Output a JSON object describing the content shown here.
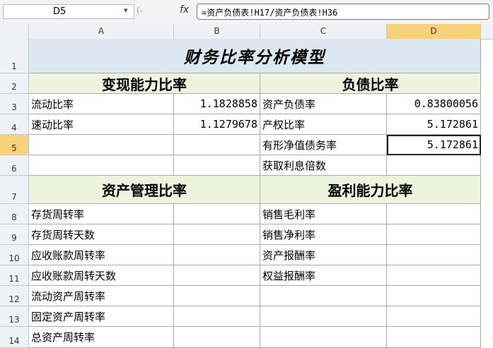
{
  "formula_bar": {
    "name_box": "D5",
    "formula": "=资产负债表!H17/资产负债表!H36",
    "fx_label": "fx"
  },
  "columns": [
    "A",
    "B",
    "C",
    "D"
  ],
  "selected_column": "D",
  "rows": [
    "1",
    "2",
    "3",
    "4",
    "5",
    "6",
    "7",
    "8",
    "9",
    "10",
    "11",
    "12",
    "13",
    "14"
  ],
  "selected_row": "5",
  "sheet": {
    "title": "财务比率分析模型",
    "sections": {
      "liquidity": "变现能力比率",
      "debt": "负债比率",
      "asset_mgmt": "资产管理比率",
      "profitability": "盈利能力比率"
    },
    "liquidity_items": [
      {
        "label": "流动比率",
        "value": "1.1828858"
      },
      {
        "label": "速动比率",
        "value": "1.1279678"
      }
    ],
    "debt_items": [
      {
        "label": "资产负债率",
        "value": "0.83800056"
      },
      {
        "label": "产权比率",
        "value": "5.172861"
      },
      {
        "label": "有形净值债务率",
        "value": "5.172861"
      },
      {
        "label": "获取利息倍数",
        "value": ""
      }
    ],
    "asset_mgmt_items": [
      "存货周转率",
      "存货周转天数",
      "应收账款周转率",
      "应收账款周转天数",
      "流动资产周转率",
      "固定资产周转率",
      "总资产周转率"
    ],
    "profit_items": [
      "销售毛利率",
      "销售净利率",
      "资产报酬率",
      "权益报酬率"
    ]
  }
}
